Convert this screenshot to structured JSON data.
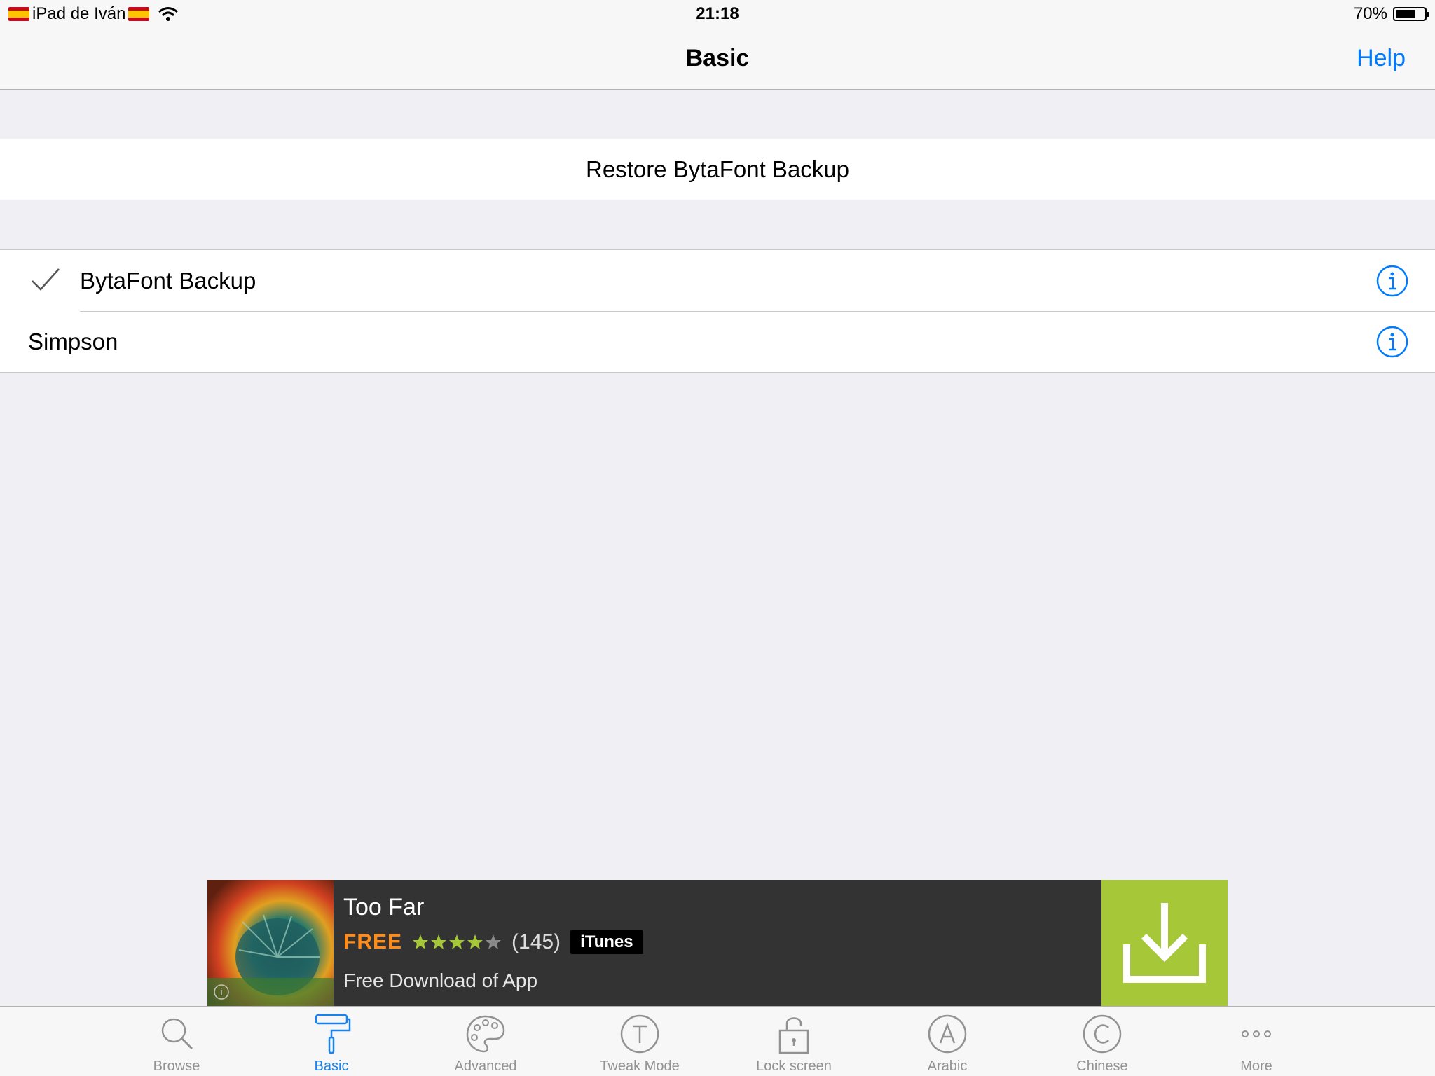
{
  "status_bar": {
    "device_name": "iPad de Iván",
    "time": "21:18",
    "battery_percent": "70%",
    "battery_level": 0.7
  },
  "nav": {
    "title": "Basic",
    "help_label": "Help"
  },
  "restore_button": "Restore BytaFont Backup",
  "font_list": [
    {
      "label": "BytaFont Backup",
      "selected": true
    },
    {
      "label": "Simpson",
      "selected": false
    }
  ],
  "ad": {
    "title": "Too Far",
    "price": "FREE",
    "rating": 4,
    "rating_count": "(145)",
    "store": "iTunes",
    "subtitle": "Free Download of App",
    "icon": "download-icon"
  },
  "tabs": [
    {
      "label": "Browse",
      "icon": "search-icon",
      "active": false
    },
    {
      "label": "Basic",
      "icon": "paint-roller-icon",
      "active": true
    },
    {
      "label": "Advanced",
      "icon": "palette-icon",
      "active": false
    },
    {
      "label": "Tweak Mode",
      "icon": "letter-t-icon",
      "active": false
    },
    {
      "label": "Lock screen",
      "icon": "lock-icon",
      "active": false
    },
    {
      "label": "Arabic",
      "icon": "letter-a-icon",
      "active": false
    },
    {
      "label": "Chinese",
      "icon": "letter-c-icon",
      "active": false
    },
    {
      "label": "More",
      "icon": "more-icon",
      "active": false
    }
  ],
  "colors": {
    "tint": "#007aff",
    "tab_active": "#1a82e8",
    "ad_price": "#ff8c1a",
    "ad_download": "#a6c838",
    "ad_background": "#333333"
  }
}
